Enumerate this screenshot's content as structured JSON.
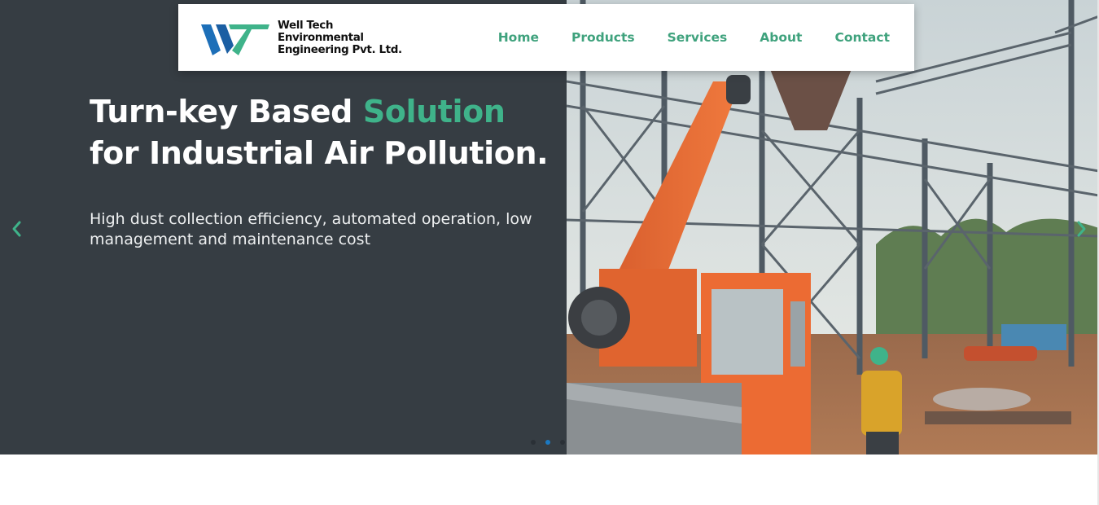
{
  "brand": {
    "name_line1": "Well Tech",
    "name_line2": "Environmental",
    "name_line3": "Engineering Pvt. Ltd.",
    "logo_icon": "wt-logo-icon",
    "colors": {
      "blue": "#1d6fb8",
      "green": "#3fb38a"
    }
  },
  "nav": {
    "items": [
      {
        "label": "Home"
      },
      {
        "label": "Products"
      },
      {
        "label": "Services"
      },
      {
        "label": "About"
      },
      {
        "label": "Contact"
      }
    ],
    "color": "#3fa27d"
  },
  "hero": {
    "headline_part1": "Turn-key Based",
    "headline_accent": "Solution",
    "headline_part2": "for Industrial Air Pollution.",
    "subtext": "High dust collection efficiency, automated operation, low management and maintenance cost",
    "background": "#363d43",
    "accent_color": "#3fb38a",
    "image": "construction-site-photo",
    "prev_icon": "chevron-left-icon",
    "next_icon": "chevron-right-icon",
    "slides": 3,
    "active_slide": 2
  }
}
